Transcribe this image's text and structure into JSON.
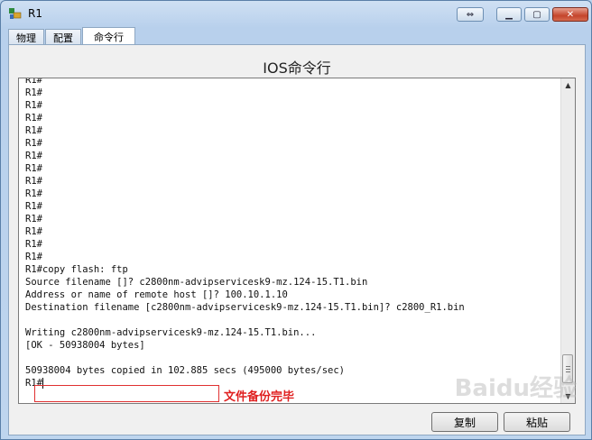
{
  "window": {
    "title": "R1"
  },
  "tabs": [
    {
      "label": "物理"
    },
    {
      "label": "配置"
    },
    {
      "label": "命令行"
    }
  ],
  "panel_title": "IOS命令行",
  "console_lines": [
    "R1#",
    "R1#",
    "R1#",
    "R1#",
    "R1#",
    "R1#",
    "R1#",
    "R1#",
    "R1#",
    "R1#",
    "R1#",
    "R1#",
    "R1#",
    "R1#",
    "R1#",
    "R1#copy flash: ftp",
    "Source filename []? c2800nm-advipservicesk9-mz.124-15.T1.bin",
    "Address or name of remote host []? 100.10.1.10",
    "Destination filename [c2800nm-advipservicesk9-mz.124-15.T1.bin]? c2800_R1.bin",
    "",
    "Writing c2800nm-advipservicesk9-mz.124-15.T1.bin...",
    "[OK - 50938004 bytes]",
    "",
    "50938004 bytes copied in 102.885 secs (495000 bytes/sec)"
  ],
  "prompt": "R1#",
  "annotation": "文件备份完毕",
  "buttons": {
    "copy": "复制",
    "paste": "粘贴"
  },
  "watermark": "Baidu经验",
  "icons": {
    "app": "router-icon",
    "restore": "restore-icon",
    "minimize": "minimize-icon",
    "maximize": "maximize-icon",
    "close": "close-icon"
  },
  "colors": {
    "annotation": "#e02020",
    "titlebar": "#bcd4ee"
  }
}
